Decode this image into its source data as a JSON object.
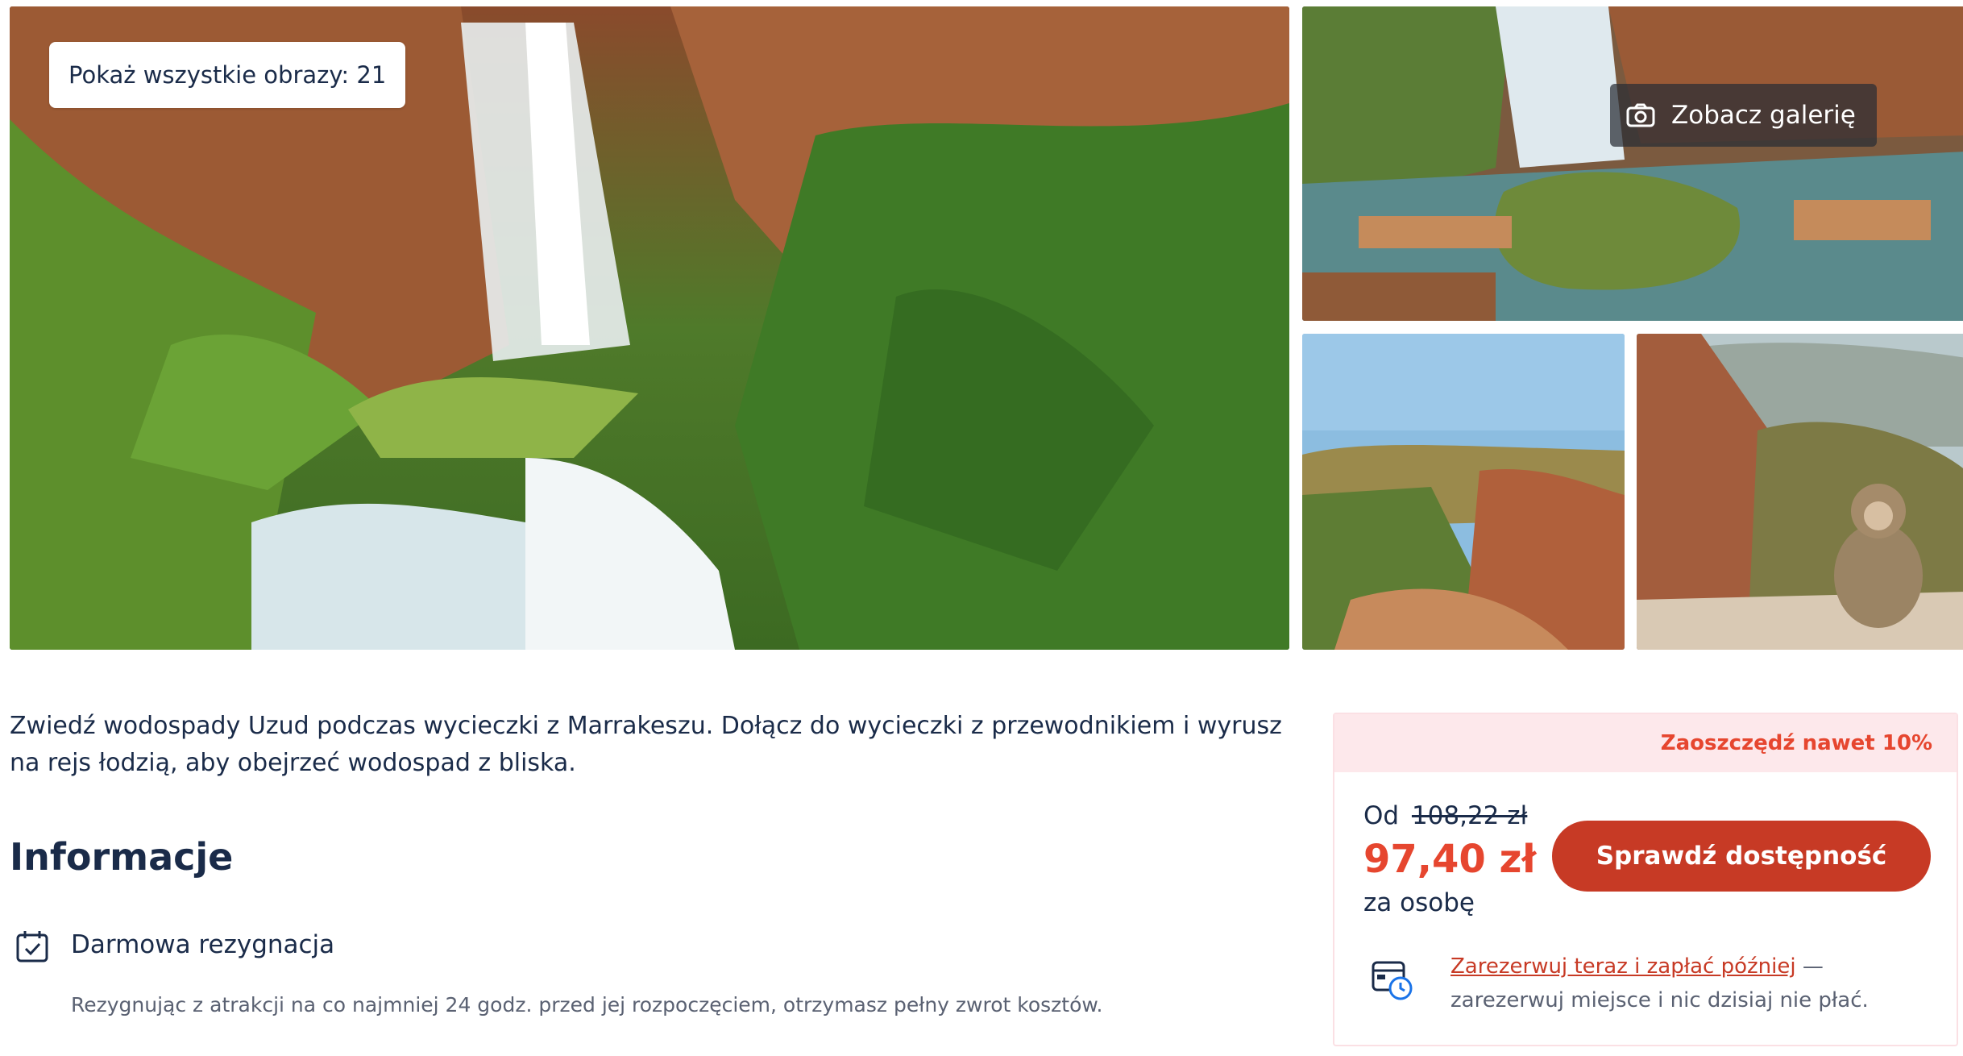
{
  "gallery": {
    "show_all_label": "Pokaż wszystkie obrazy: 21",
    "see_gallery_label": "Zobacz galerię",
    "photos": [
      {
        "name": "waterfall-main-photo"
      },
      {
        "name": "waterfall-boats-photo"
      },
      {
        "name": "canyon-photo"
      },
      {
        "name": "monkey-photo"
      }
    ]
  },
  "description": "Zwiedź wodospady Uzud podczas wycieczki z Marrakeszu. Dołącz do wycieczki z przewodnikiem i wyrusz na rejs łodzią, aby obejrzeć wodospad z bliska.",
  "info": {
    "title": "Informacje",
    "items": [
      {
        "icon": "calendar-check-icon",
        "title": "Darmowa rezygnacja",
        "description": "Rezygnując z atrakcji na co najmniej 24 godz. przed jej rozpoczęciem, otrzymasz pełny zwrot kosztów."
      }
    ]
  },
  "booking": {
    "promo": "Zaoszczędź nawet 10%",
    "from_label": "Od",
    "old_price": "108,22 zł",
    "new_price": "97,40 zł",
    "unit": "za osobę",
    "check_button": "Sprawdź dostępność",
    "reserve_link": "Zarezerwuj teraz i zapłać później",
    "reserve_rest": " — zarezerwuj miejsce i nic dzisiaj nie płać.",
    "reserve_icon": "calendar-clock-icon"
  },
  "colors": {
    "accent": "#c73a25",
    "promo_text": "#e6462f",
    "promo_bg": "#fde8eb",
    "text": "#1a2b49"
  }
}
